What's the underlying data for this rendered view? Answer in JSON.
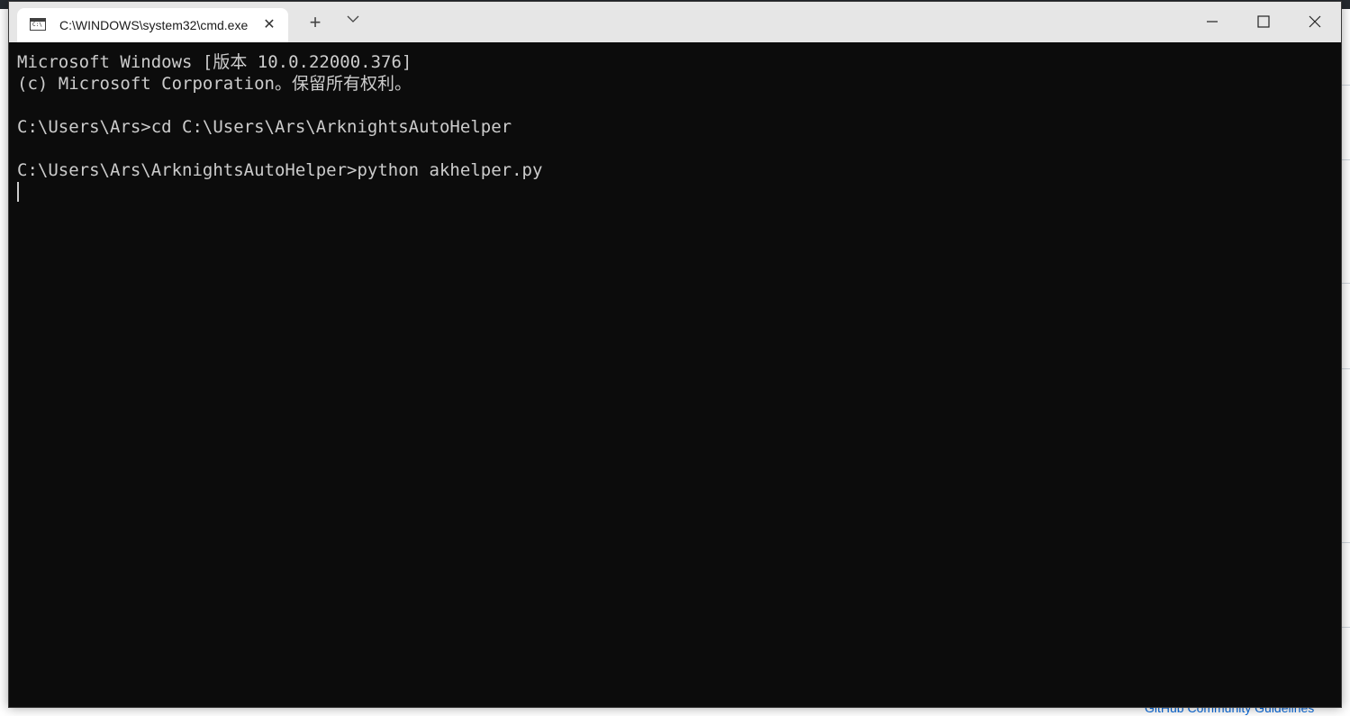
{
  "window": {
    "tab_title": "C:\\WINDOWS\\system32\\cmd.exe",
    "tab_icon_text": "C:\\",
    "new_tab_symbol": "+",
    "close_tab_symbol": "✕"
  },
  "terminal": {
    "lines": [
      "Microsoft Windows [版本 10.0.22000.376]",
      "(c) Microsoft Corporation。保留所有权利。",
      "",
      "C:\\Users\\Ars>cd C:\\Users\\Ars\\ArknightsAutoHelper",
      "",
      "C:\\Users\\Ars\\ArknightsAutoHelper>python akhelper.py"
    ]
  },
  "background": {
    "footer_link": "GitHub Community Guidelines"
  },
  "colors": {
    "terminal_bg": "#0c0c0c",
    "terminal_fg": "#cccccc",
    "titlebar_bg": "#e6e6e6",
    "tab_bg": "#ffffff"
  }
}
